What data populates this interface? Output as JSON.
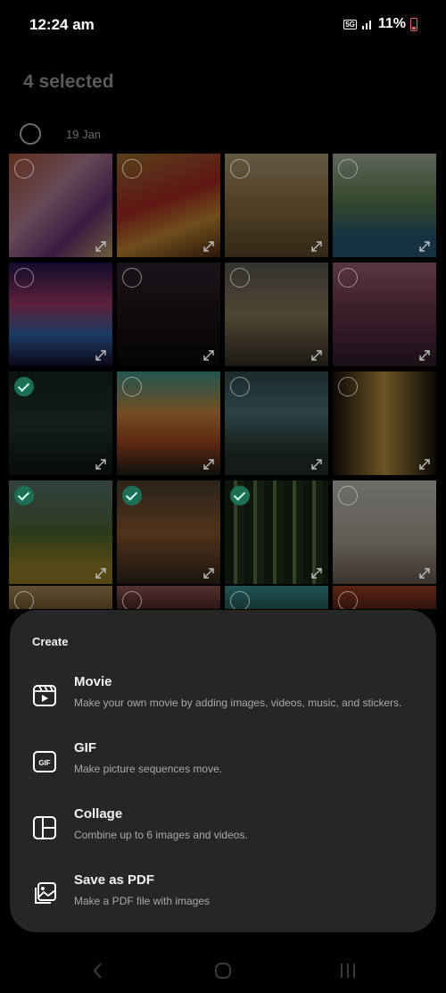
{
  "status_bar": {
    "time": "12:24 am",
    "network": "5G",
    "battery": "11%"
  },
  "gallery": {
    "selection_title": "4 selected",
    "date_group": "19 Jan",
    "thumbnails": [
      {
        "description": "krishna-radha-painting",
        "selected": false
      },
      {
        "description": "krishna-painting",
        "selected": false
      },
      {
        "description": "ram-court-painting",
        "selected": false
      },
      {
        "description": "krishna-tree-painting",
        "selected": false
      },
      {
        "description": "pixel-city-night",
        "selected": false
      },
      {
        "description": "dark-mountain-silhouette",
        "selected": false
      },
      {
        "description": "lake-sunset-landscape",
        "selected": false
      },
      {
        "description": "pink-city-skyline",
        "selected": false
      },
      {
        "description": "dark-forest",
        "selected": true
      },
      {
        "description": "orange-mountain-forest",
        "selected": false
      },
      {
        "description": "waterfall-landscape",
        "selected": false
      },
      {
        "description": "arch-silhouette",
        "selected": false
      },
      {
        "description": "river-valley",
        "selected": true
      },
      {
        "description": "orange-cliff",
        "selected": true
      },
      {
        "description": "bamboo-forest",
        "selected": true
      },
      {
        "description": "bare-tree-reflection",
        "selected": false
      }
    ]
  },
  "sheet": {
    "title": "Create",
    "options": [
      {
        "icon": "movie-icon",
        "title": "Movie",
        "description": "Make your own movie by adding images, videos, music, and stickers."
      },
      {
        "icon": "gif-icon",
        "title": "GIF",
        "description": "Make picture sequences move."
      },
      {
        "icon": "collage-icon",
        "title": "Collage",
        "description": "Combine up to 6 images and videos."
      },
      {
        "icon": "pdf-icon",
        "title": "Save as PDF",
        "description": "Make a PDF file with images"
      }
    ]
  },
  "colors": {
    "sheet_bg": "#262626",
    "selected_check": "#1c6e55"
  }
}
